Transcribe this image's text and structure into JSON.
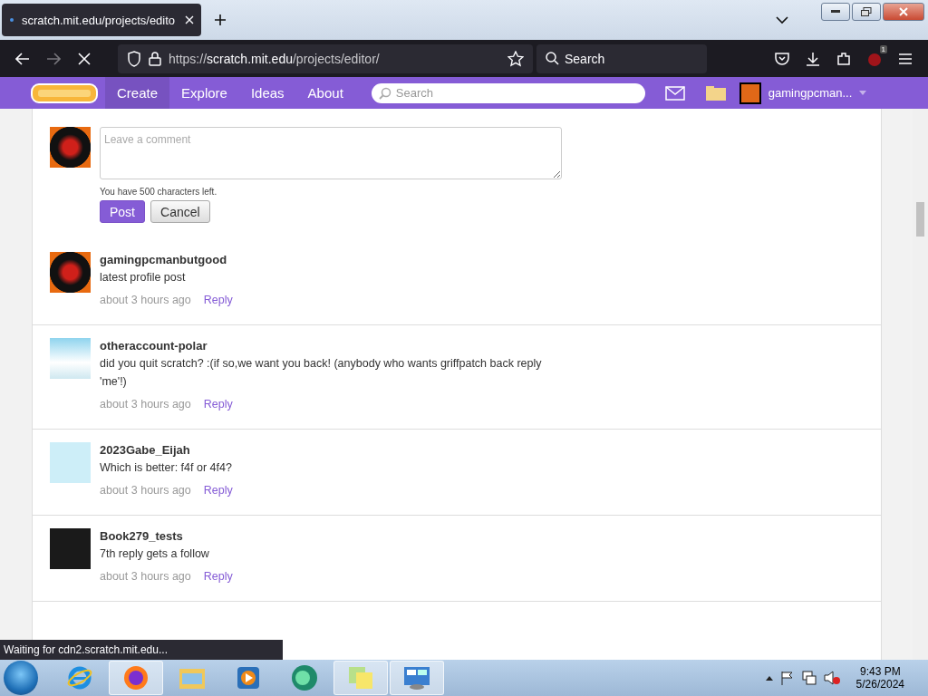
{
  "browser": {
    "tabs": [
      {
        "title": "scratch.mit.edu/projects/edito",
        "selected": true
      }
    ],
    "url": "https://**scratch.mit.edu**/projects/editor/",
    "search_placeholder": "Search",
    "extension_badge": "1",
    "status": "Waiting for cdn2.scratch.mit.edu..."
  },
  "nav": {
    "items": [
      {
        "label": "Create",
        "selected": true
      },
      {
        "label": "Explore",
        "selected": false
      },
      {
        "label": "Ideas",
        "selected": false
      },
      {
        "label": "About",
        "selected": false
      }
    ],
    "search_placeholder": "Search",
    "username": "gamingpcman..."
  },
  "comment_form": {
    "placeholder": "Leave a comment",
    "chars_left": "You have 500 characters left.",
    "buttons": [
      {
        "label": "Post",
        "kind": "primary"
      },
      {
        "label": "Cancel",
        "kind": "secondary"
      }
    ]
  },
  "comments": [
    {
      "author": "gamingpcmanbutgood",
      "text": "latest profile post",
      "time": "about 3 hours ago",
      "reply": "Reply",
      "avatar": {
        "kind": "fire"
      }
    },
    {
      "author": "otheraccount-polar",
      "text": "did you quit scratch? :(if so,we want you back! (anybody who wants griffpatch back reply 'me'!)",
      "time": "about 3 hours ago",
      "reply": "Reply",
      "avatar": {
        "kind": "sky"
      }
    },
    {
      "author": "2023Gabe_Eijah",
      "text": "Which is better: f4f or 4f4?",
      "time": "about 3 hours ago",
      "reply": "Reply",
      "avatar": {
        "kind": "light"
      }
    },
    {
      "author": "Book279_tests",
      "text": "7th reply gets a follow",
      "time": "about 3 hours ago",
      "reply": "Reply",
      "avatar": {
        "kind": "dark"
      }
    }
  ],
  "taskbar": {
    "apps": [
      {
        "kind": "ie",
        "selected": false
      },
      {
        "kind": "firefox",
        "selected": true
      },
      {
        "kind": "explorer",
        "selected": false
      },
      {
        "kind": "media",
        "selected": false
      },
      {
        "kind": "globe",
        "selected": false
      },
      {
        "kind": "notes",
        "selected": true
      },
      {
        "kind": "panel",
        "selected": true
      }
    ],
    "time": "9:43 PM",
    "date": "5/26/2024"
  }
}
